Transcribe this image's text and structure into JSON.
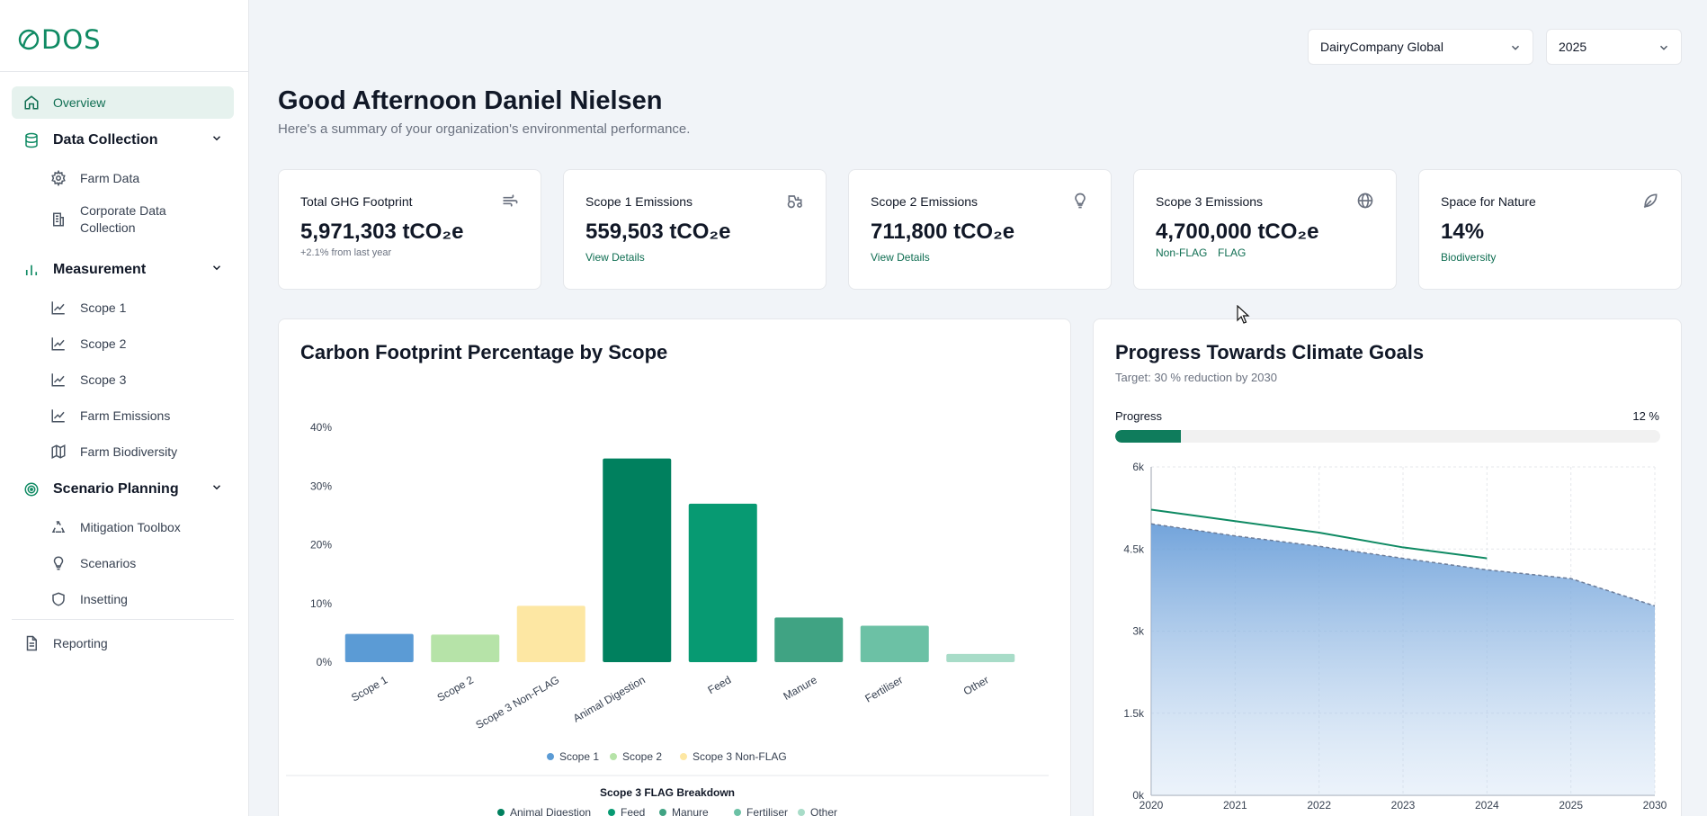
{
  "logo": {
    "text": "DOS"
  },
  "sidebar": {
    "items": [
      {
        "label": "Overview",
        "icon": "home-icon"
      },
      {
        "label": "Data Collection",
        "icon": "database-icon"
      },
      {
        "label": "Farm Data",
        "icon": "gear-icon"
      },
      {
        "label": "Corporate Data",
        "label2": "Collection",
        "icon": "building-icon"
      },
      {
        "label": "Measurement",
        "icon": "bar-chart-icon"
      },
      {
        "label": "Scope 1",
        "icon": "line-chart-icon"
      },
      {
        "label": "Scope 2",
        "icon": "line-chart-icon"
      },
      {
        "label": "Scope 3",
        "icon": "line-chart-icon"
      },
      {
        "label": "Farm Emissions",
        "icon": "line-chart-icon"
      },
      {
        "label": "Farm Biodiversity",
        "icon": "map-icon"
      },
      {
        "label": "Scenario Planning",
        "icon": "target-icon"
      },
      {
        "label": "Mitigation Toolbox",
        "icon": "recycle-icon"
      },
      {
        "label": "Scenarios",
        "icon": "lightbulb-icon"
      },
      {
        "label": "Insetting",
        "icon": "shield-icon"
      },
      {
        "label": "Reporting",
        "icon": "file-text-icon"
      }
    ]
  },
  "header": {
    "company_select": "DairyCompany Global",
    "year_select": "2025",
    "greeting": "Good Afternoon Daniel Nielsen",
    "subtitle": "Here's a summary of your organization's environmental performance."
  },
  "kpis": [
    {
      "label": "Total GHG Footprint",
      "value": "5,971,303 tCO₂e",
      "note": "+2.1% from last year",
      "icon": "wind-icon"
    },
    {
      "label": "Scope 1 Emissions",
      "value": "559,503 tCO₂e",
      "link": "View Details",
      "icon": "tractor-icon"
    },
    {
      "label": "Scope 2 Emissions",
      "value": "711,800 tCO₂e",
      "link": "View Details",
      "icon": "lightbulb-icon"
    },
    {
      "label": "Scope 3 Emissions",
      "value": "4,700,000 tCO₂e",
      "link1": "Non-FLAG",
      "link2": "FLAG",
      "icon": "globe-icon"
    },
    {
      "label": "Space for Nature",
      "value": "14%",
      "link": "Biodiversity",
      "icon": "leaf-icon"
    }
  ],
  "colors": {
    "brand": "#0f8a63",
    "scope1": "#5b9bd5",
    "scope2": "#b6e3a8",
    "scope3_nonflag": "#fde7a3",
    "animal_digestion": "#00805e",
    "feed": "#079a72",
    "manure": "#40a383",
    "fertiliser": "#6cc1a5",
    "other": "#a8dcc8"
  },
  "chart_data": [
    {
      "type": "bar",
      "title": "Carbon Footprint Percentage by Scope",
      "categories": [
        "Scope 1",
        "Scope 2",
        "Scope 3 Non-FLAG",
        "Animal Digestion",
        "Feed",
        "Manure",
        "Fertiliser",
        "Other"
      ],
      "values": [
        4.8,
        4.7,
        9.6,
        34.7,
        27,
        7.6,
        6.2,
        1.4
      ],
      "yticks": [
        "0%",
        "10%",
        "20%",
        "30%",
        "40%"
      ],
      "ylim": [
        0,
        40
      ],
      "legend": [
        "Scope 1",
        "Scope 2",
        "Scope 3 Non-FLAG"
      ],
      "legend_position": "bottom",
      "breakdown_title": "Scope 3 FLAG Breakdown",
      "breakdown_legend": [
        "Animal Digestion",
        "Feed",
        "Manure",
        "Fertiliser",
        "Other"
      ]
    },
    {
      "type": "area",
      "title": "Progress Towards Climate Goals",
      "target": "Target: 30 % reduction by 2030",
      "progress_label": "Progress",
      "progress_value": "12 %",
      "progress_fraction": 0.12,
      "x": [
        "2020",
        "2021",
        "2022",
        "2023",
        "2024",
        "2025",
        "2030"
      ],
      "yticks": [
        "0k",
        "1.5k",
        "3k",
        "4.5k",
        "6k"
      ],
      "ylim": [
        0,
        6000
      ],
      "series": [
        {
          "values": [
            4960,
            4740,
            4550,
            4330,
            4120,
            3960,
            3460
          ]
        },
        {
          "values": [
            5220,
            5010,
            4800,
            4530,
            4330
          ]
        }
      ],
      "grid": true
    }
  ]
}
